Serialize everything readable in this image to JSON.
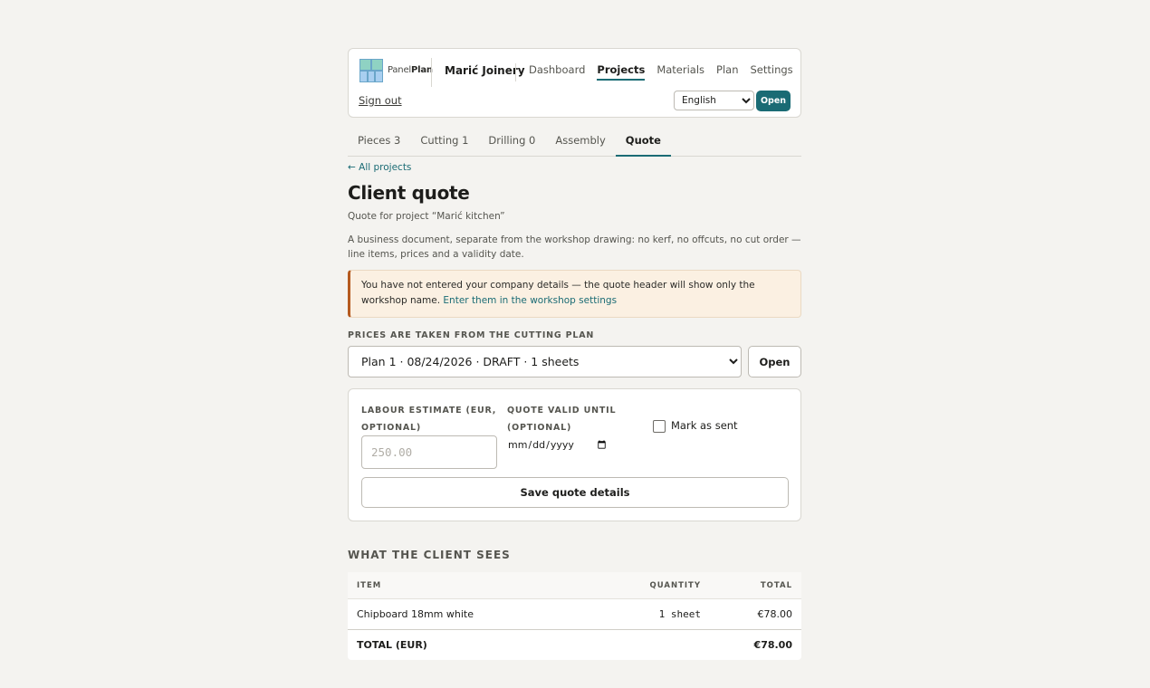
{
  "header": {
    "brand_part1": "Panel",
    "brand_part2": "Plan",
    "workshop_name": "Marić Joinery",
    "nav": [
      {
        "label": "Dashboard"
      },
      {
        "label": "Projects"
      },
      {
        "label": "Materials"
      },
      {
        "label": "Plan"
      },
      {
        "label": "Settings"
      }
    ],
    "active_nav": "Projects",
    "sign_out": "Sign out",
    "language": "English",
    "language_open": "Open"
  },
  "tabs": [
    {
      "label": "Pieces 3"
    },
    {
      "label": "Cutting 1"
    },
    {
      "label": "Drilling 0"
    },
    {
      "label": "Assembly"
    },
    {
      "label": "Quote"
    }
  ],
  "active_tab": "Quote",
  "back_link": "← All projects",
  "page": {
    "title": "Client quote",
    "subtitle": "Quote for project “Marić kitchen”",
    "description": "A business document, separate from the workshop drawing: no kerf, no offcuts, no cut order — line items, prices and a validity date."
  },
  "alert": {
    "text": "You have not entered your company details — the quote header will show only the workshop name.",
    "link": "Enter them in the workshop settings"
  },
  "plan": {
    "label": "Prices are taken from the cutting plan",
    "selected": "Plan 1 · 08/24/2026 · DRAFT · 1 sheets",
    "open_label": "Open"
  },
  "form": {
    "labour_label": "Labour estimate (EUR, optional)",
    "labour_placeholder": "250.00",
    "valid_label": "Quote valid until (optional)",
    "mark_sent_label": "Mark as sent",
    "mark_sent_checked": false,
    "save_label": "Save quote details"
  },
  "client_view": {
    "label": "What the client sees",
    "columns": [
      "ITEM",
      "QUANTITY",
      "TOTAL"
    ],
    "rows": [
      {
        "item": "Chipboard 18mm white",
        "quantity": "1 sheet",
        "total": "€78.00"
      }
    ],
    "total_label": "TOTAL (EUR)",
    "total_value": "€78.00"
  },
  "colors": {
    "accent": "#1a6b74",
    "alert_border": "#b55a1f",
    "alert_bg": "#fbf0e2",
    "background": "#f4f3f0"
  }
}
